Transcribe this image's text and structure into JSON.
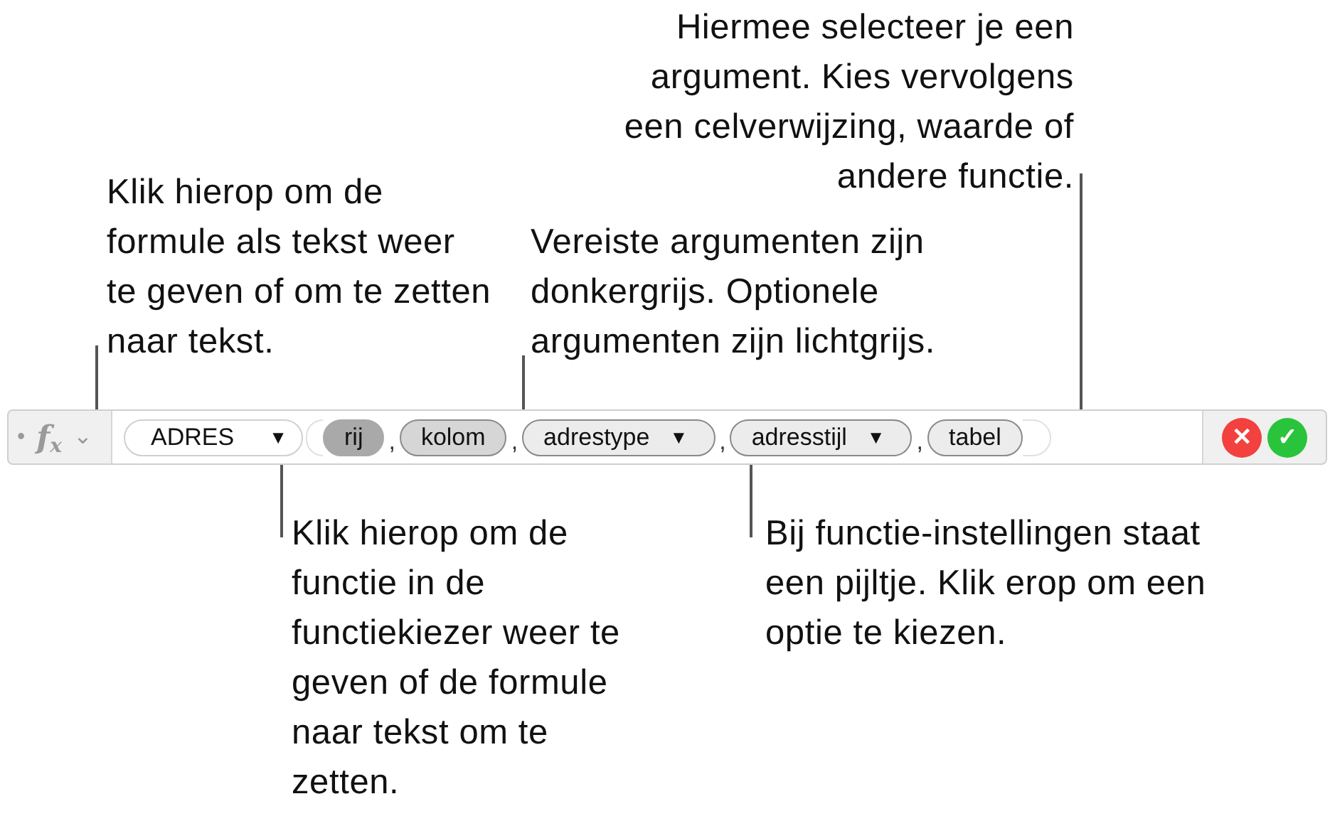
{
  "formula_bar": {
    "bullet": "•",
    "fx_label": "f",
    "fx_sub": "x",
    "chevron": "⌄",
    "function": {
      "name": "ADRES",
      "arrow": "▼"
    },
    "arguments": [
      {
        "label": "rij",
        "kind": "required",
        "selected": true,
        "dropdown": false
      },
      {
        "label": "kolom",
        "kind": "required",
        "selected": false,
        "dropdown": false,
        "separator": ","
      },
      {
        "label": "adrestype",
        "kind": "optional",
        "selected": false,
        "dropdown": true,
        "separator": ","
      },
      {
        "label": "adresstijl",
        "kind": "optional",
        "selected": false,
        "dropdown": true,
        "separator": ","
      },
      {
        "label": "tabel",
        "kind": "optional",
        "selected": false,
        "dropdown": false,
        "separator": ","
      }
    ],
    "cancel": "✕",
    "accept": "✓"
  },
  "callouts": [
    {
      "text": "Hiermee selecteer je een argument. Kies vervolgens een celverwijzing, waarde of andere functie."
    },
    {
      "text": "Klik hierop om de formule als tekst weer te geven of om te zetten naar tekst."
    },
    {
      "text": "Vereiste argumenten zijn donkergrijs. Optionele argumenten zijn lichtgrijs."
    },
    {
      "text": "Klik hierop om de functie in de functiekiezer weer te geven of de formule naar tekst om te zetten."
    },
    {
      "text": "Bij functie-instellingen staat een pijltje. Klik erop om een optie te kiezen."
    }
  ]
}
